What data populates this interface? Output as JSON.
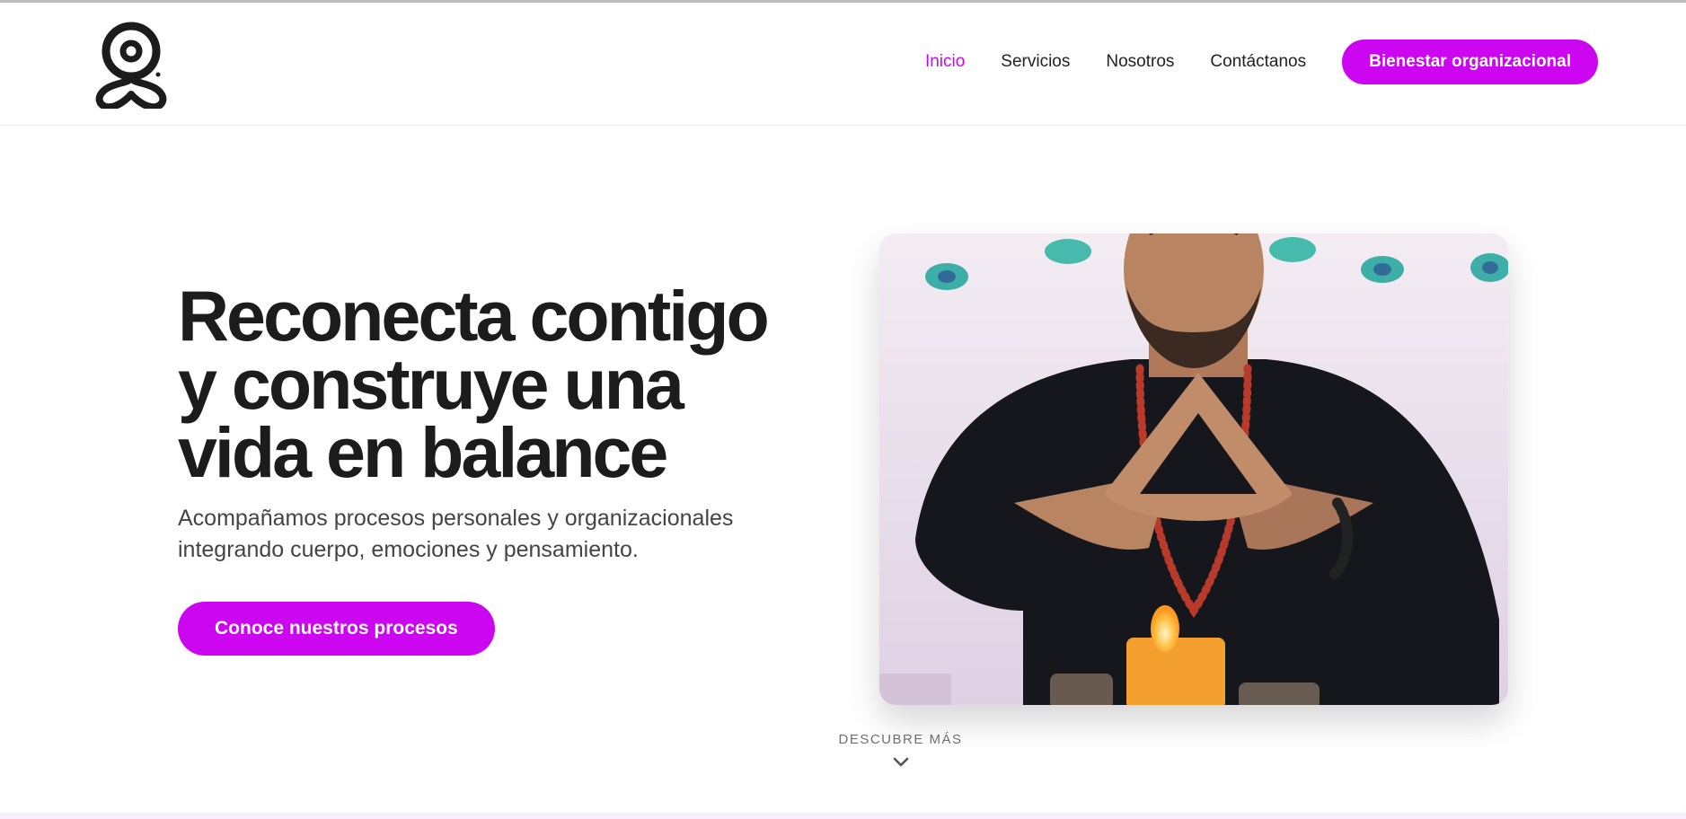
{
  "colors": {
    "accent": "#cc06f0",
    "text": "#1c1c1c",
    "muted": "#444444"
  },
  "header": {
    "logo_icon": "meditation-figure-logo",
    "nav": [
      {
        "label": "Inicio",
        "active": true
      },
      {
        "label": "Servicios",
        "active": false
      },
      {
        "label": "Nosotros",
        "active": false
      },
      {
        "label": "Contáctanos",
        "active": false
      }
    ],
    "cta_label": "Bienestar organizacional"
  },
  "hero": {
    "title_lines": [
      "Reconecta contigo",
      "y construye una",
      "vida en balance"
    ],
    "subtitle_lines": [
      "Acompañamos procesos personales y organizacionales",
      "integrando cuerpo, emociones y pensamiento."
    ],
    "cta_label": "Conoce nuestros procesos",
    "image_alt_icon": "meditating-man-photo"
  },
  "discover": {
    "label": "DESCUBRE MÁS",
    "icon": "chevron-down-icon"
  }
}
